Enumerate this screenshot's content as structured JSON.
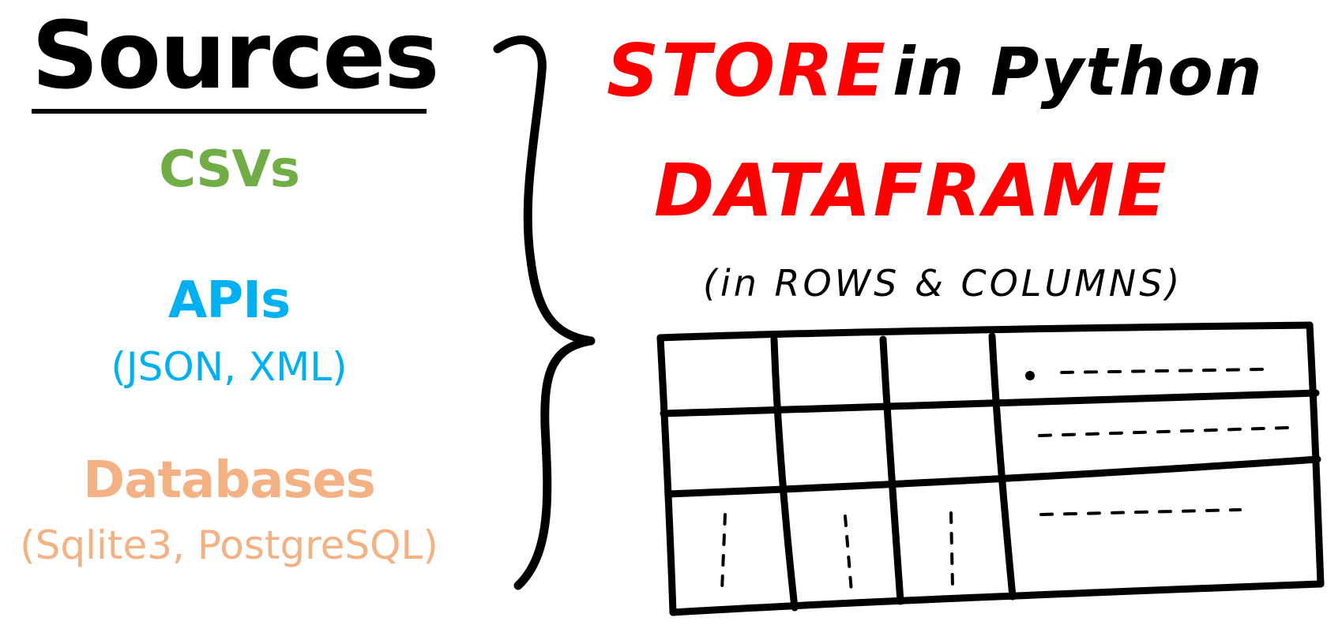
{
  "sources": {
    "title": "Sources",
    "items": [
      {
        "name": "CSVs",
        "detail": "",
        "color": "#70ad47"
      },
      {
        "name": "APIs",
        "detail": "(JSON, XML)",
        "color": "#00b0f0"
      },
      {
        "name": "Databases",
        "detail": "(Sqlite3, PostgreSQL)",
        "color": "#f4b183"
      }
    ]
  },
  "target": {
    "store_word": "STORE",
    "in_python": "in Python",
    "dataframe": "DATAFRAME",
    "subtitle": "(in ROWS & COLUMNS)",
    "accent_color": "#ff0000"
  },
  "table_sketch": {
    "rows": 3,
    "columns": 4
  }
}
